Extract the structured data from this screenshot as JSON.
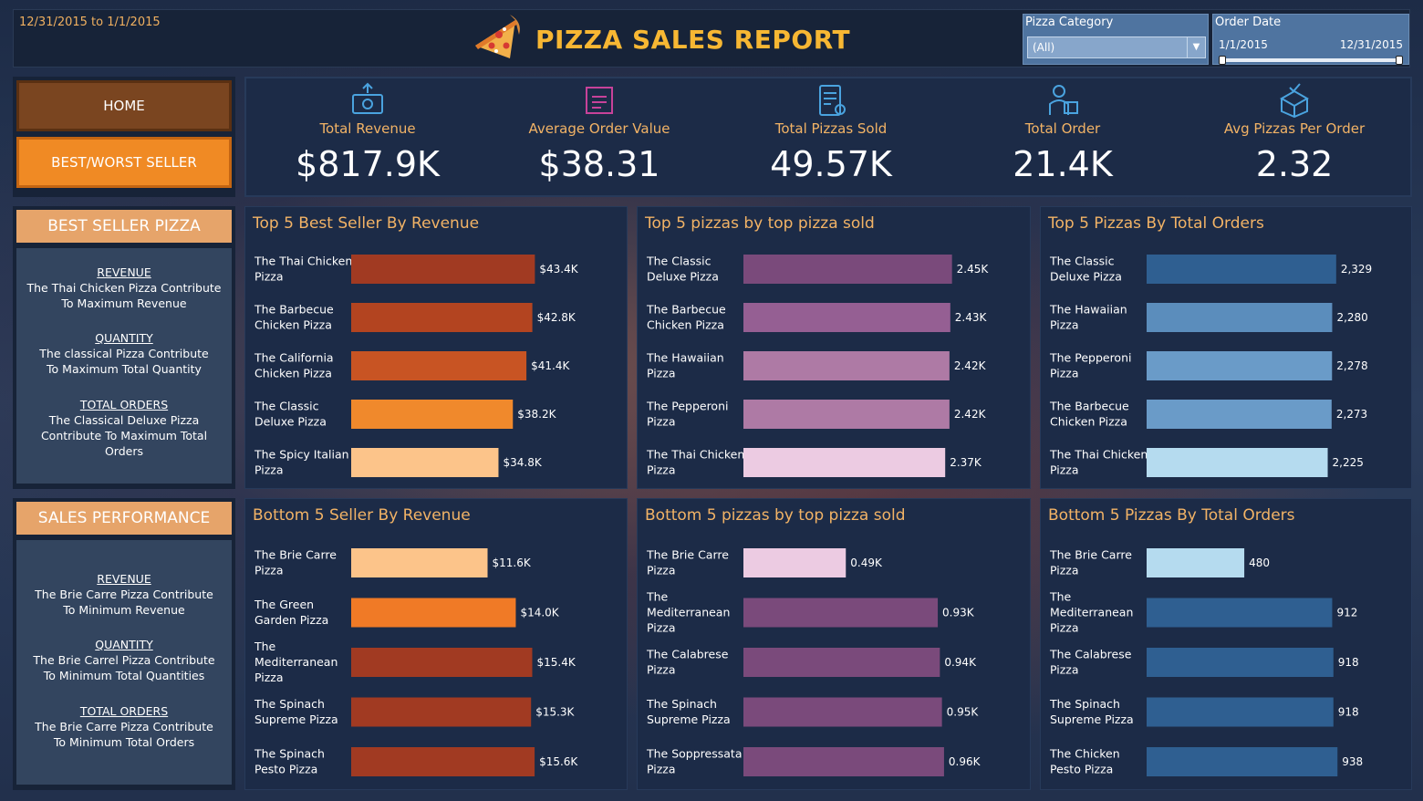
{
  "header": {
    "date_range": "12/31/2015 to 1/1/2015",
    "title": "PIZZA SALES REPORT",
    "pizza_category": {
      "label": "Pizza Category",
      "value": "(All)"
    },
    "order_date": {
      "label": "Order Date",
      "start": "1/1/2015",
      "end": "12/31/2015"
    }
  },
  "nav": {
    "home": "HOME",
    "best_worst": "BEST/WORST SELLER"
  },
  "kpis": [
    {
      "icon": "money-icon",
      "label": "Total Revenue",
      "value": "$817.9K"
    },
    {
      "icon": "order-value-icon",
      "label": "Average Order Value",
      "value": "$38.31"
    },
    {
      "icon": "pizzas-sold-icon",
      "label": "Total Pizzas Sold",
      "value": "49.57K"
    },
    {
      "icon": "delivery-icon",
      "label": "Total Order",
      "value": "21.4K"
    },
    {
      "icon": "box-icon",
      "label": "Avg Pizzas Per Order",
      "value": "2.32"
    }
  ],
  "best_panel": {
    "title": "BEST SELLER PIZZA",
    "sections": [
      {
        "head": "REVENUE",
        "text": "The Thai Chicken Pizza Contribute To Maximum Revenue"
      },
      {
        "head": "QUANTITY",
        "text": "The classical Pizza Contribute To Maximum Total Quantity"
      },
      {
        "head": "TOTAL ORDERS",
        "text": "The Classical Deluxe Pizza Contribute To Maximum Total Orders"
      }
    ]
  },
  "sales_panel": {
    "title": "SALES PERFORMANCE",
    "sections": [
      {
        "head": "REVENUE",
        "text": "The Brie Carre Pizza Contribute To Minimum Revenue"
      },
      {
        "head": "QUANTITY",
        "text": "The Brie Carrel Pizza Contribute To Minimum Total Quantities"
      },
      {
        "head": "TOTAL ORDERS",
        "text": "The Brie Carre Pizza Contribute To Minimum Total Orders"
      }
    ]
  },
  "colors": {
    "accent": "#f2b366",
    "kpi_icon": "#4aa3df",
    "kpi_icon_alt": "#c8429a"
  },
  "chart_data": [
    {
      "id": "top-revenue",
      "type": "bar",
      "orientation": "horizontal",
      "title": "Top 5 Best Seller By Revenue",
      "categories": [
        [
          "The Thai Chicken",
          "Pizza"
        ],
        [
          "The Barbecue",
          "Chicken Pizza"
        ],
        [
          "The California",
          "Chicken Pizza"
        ],
        [
          "The Classic",
          "Deluxe Pizza"
        ],
        [
          "The Spicy Italian",
          "Pizza"
        ]
      ],
      "values": [
        43.4,
        42.8,
        41.4,
        38.2,
        34.8
      ],
      "labels": [
        "$43.4K",
        "$42.8K",
        "$41.4K",
        "$38.2K",
        "$34.8K"
      ],
      "colors": [
        "#a13a22",
        "#b34420",
        "#c85423",
        "#f0892c",
        "#fcc48a"
      ],
      "xlim": [
        0,
        50
      ]
    },
    {
      "id": "top-sold",
      "type": "bar",
      "orientation": "horizontal",
      "title": "Top 5 pizzas by top pizza sold",
      "categories": [
        [
          "The Classic",
          "Deluxe Pizza"
        ],
        [
          "The Barbecue",
          "Chicken Pizza"
        ],
        [
          "The Hawaiian",
          "Pizza"
        ],
        [
          "The Pepperoni",
          "Pizza"
        ],
        [
          "The Thai Chicken",
          "Pizza"
        ]
      ],
      "values": [
        2.45,
        2.43,
        2.42,
        2.42,
        2.37
      ],
      "labels": [
        "2.45K",
        "2.43K",
        "2.42K",
        "2.42K",
        "2.37K"
      ],
      "colors": [
        "#7a4a7b",
        "#955f93",
        "#ae7aa5",
        "#ae7aa5",
        "#eccbe2"
      ],
      "xlim": [
        0,
        2.7
      ]
    },
    {
      "id": "top-orders",
      "type": "bar",
      "orientation": "horizontal",
      "title": "Top 5 Pizzas By Total Orders",
      "categories": [
        [
          "The Classic",
          "Deluxe Pizza"
        ],
        [
          "The Hawaiian",
          "Pizza"
        ],
        [
          "The Pepperoni",
          "Pizza"
        ],
        [
          "The Barbecue",
          "Chicken Pizza"
        ],
        [
          "The Thai Chicken",
          "Pizza"
        ]
      ],
      "values": [
        2329,
        2280,
        2278,
        2273,
        2225
      ],
      "labels": [
        "2,329",
        "2,280",
        "2,278",
        "2,273",
        "2,225"
      ],
      "colors": [
        "#2f5f91",
        "#5b8dbc",
        "#6a9bc8",
        "#6a9bc8",
        "#b5dbef"
      ],
      "xlim": [
        0,
        2600
      ]
    },
    {
      "id": "bottom-revenue",
      "type": "bar",
      "orientation": "horizontal",
      "title": "Bottom 5 Seller By Revenue",
      "categories": [
        [
          "The Brie Carre",
          "Pizza"
        ],
        [
          "The Green",
          "Garden Pizza"
        ],
        [
          "The",
          "Mediterranean",
          "Pizza"
        ],
        [
          "The Spinach",
          "Supreme Pizza"
        ],
        [
          "The Spinach",
          "Pesto Pizza"
        ]
      ],
      "values": [
        11.6,
        14.0,
        15.4,
        15.3,
        15.6
      ],
      "labels": [
        "$11.6K",
        "$14.0K",
        "$15.4K",
        "$15.3K",
        "$15.6K"
      ],
      "colors": [
        "#fcc48a",
        "#f07a26",
        "#a13a22",
        "#a13a22",
        "#a13a22"
      ],
      "xlim": [
        0,
        18
      ]
    },
    {
      "id": "bottom-sold",
      "type": "bar",
      "orientation": "horizontal",
      "title": "Bottom 5 pizzas by top pizza sold",
      "categories": [
        [
          "The Brie Carre",
          "Pizza"
        ],
        [
          "The",
          "Mediterranean",
          "Pizza"
        ],
        [
          "The Calabrese",
          "Pizza"
        ],
        [
          "The Spinach",
          "Supreme Pizza"
        ],
        [
          "The Soppressata",
          "Pizza"
        ]
      ],
      "values": [
        0.49,
        0.93,
        0.94,
        0.95,
        0.96
      ],
      "labels": [
        "0.49K",
        "0.93K",
        "0.94K",
        "0.95K",
        "0.96K"
      ],
      "colors": [
        "#eccbe2",
        "#7a4a7b",
        "#7a4a7b",
        "#7a4a7b",
        "#7a4a7b"
      ],
      "xlim": [
        0,
        1.1
      ]
    },
    {
      "id": "bottom-orders",
      "type": "bar",
      "orientation": "horizontal",
      "title": "Bottom 5 Pizzas By Total Orders",
      "categories": [
        [
          "The Brie Carre",
          "Pizza"
        ],
        [
          "The",
          "Mediterranean",
          "Pizza"
        ],
        [
          "The Calabrese",
          "Pizza"
        ],
        [
          "The Spinach",
          "Supreme Pizza"
        ],
        [
          "The Chicken",
          "Pesto Pizza"
        ]
      ],
      "values": [
        480,
        912,
        918,
        918,
        938
      ],
      "labels": [
        "480",
        "912",
        "918",
        "918",
        "938"
      ],
      "colors": [
        "#b5dbef",
        "#2f5f91",
        "#2f5f91",
        "#2f5f91",
        "#2f5f91"
      ],
      "xlim": [
        0,
        1040
      ]
    }
  ]
}
